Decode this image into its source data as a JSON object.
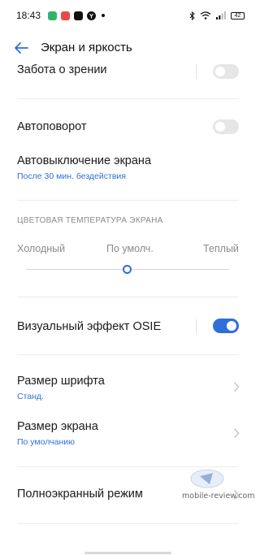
{
  "status_bar": {
    "time": "18:43",
    "battery": "42",
    "notification_icons": [
      "green-app-icon",
      "red-app-icon",
      "youtube-icon",
      "yandex-icon",
      "more-dot-icon"
    ],
    "right_icons": [
      "bluetooth-icon",
      "wifi-icon",
      "signal-icon",
      "battery-icon"
    ]
  },
  "header": {
    "title": "Экран и яркость",
    "accent": "#2f6fd7"
  },
  "settings": {
    "eye_care": {
      "label": "Забота о зрении",
      "enabled": false
    },
    "auto_rotate": {
      "label": "Автоповорот",
      "enabled": false
    },
    "screen_timeout": {
      "label": "Автовыключение экрана",
      "value": "После 30 мин. бездействия"
    },
    "color_temperature": {
      "section_title": "ЦВЕТОВАЯ ТЕМПЕРАТУРА ЭКРАНА",
      "cold": "Холодный",
      "default": "По умолч.",
      "warm": "Теплый",
      "level": 0.5
    },
    "osie": {
      "label": "Визуальный эффект OSIE",
      "enabled": true
    },
    "font_size": {
      "label": "Размер шрифта",
      "value": "Станд."
    },
    "display_size": {
      "label": "Размер экрана",
      "value": "По умолчанию"
    },
    "fullscreen": {
      "label": "Полноэкранный режим"
    }
  },
  "watermark": {
    "text": "mobile-review.com"
  }
}
